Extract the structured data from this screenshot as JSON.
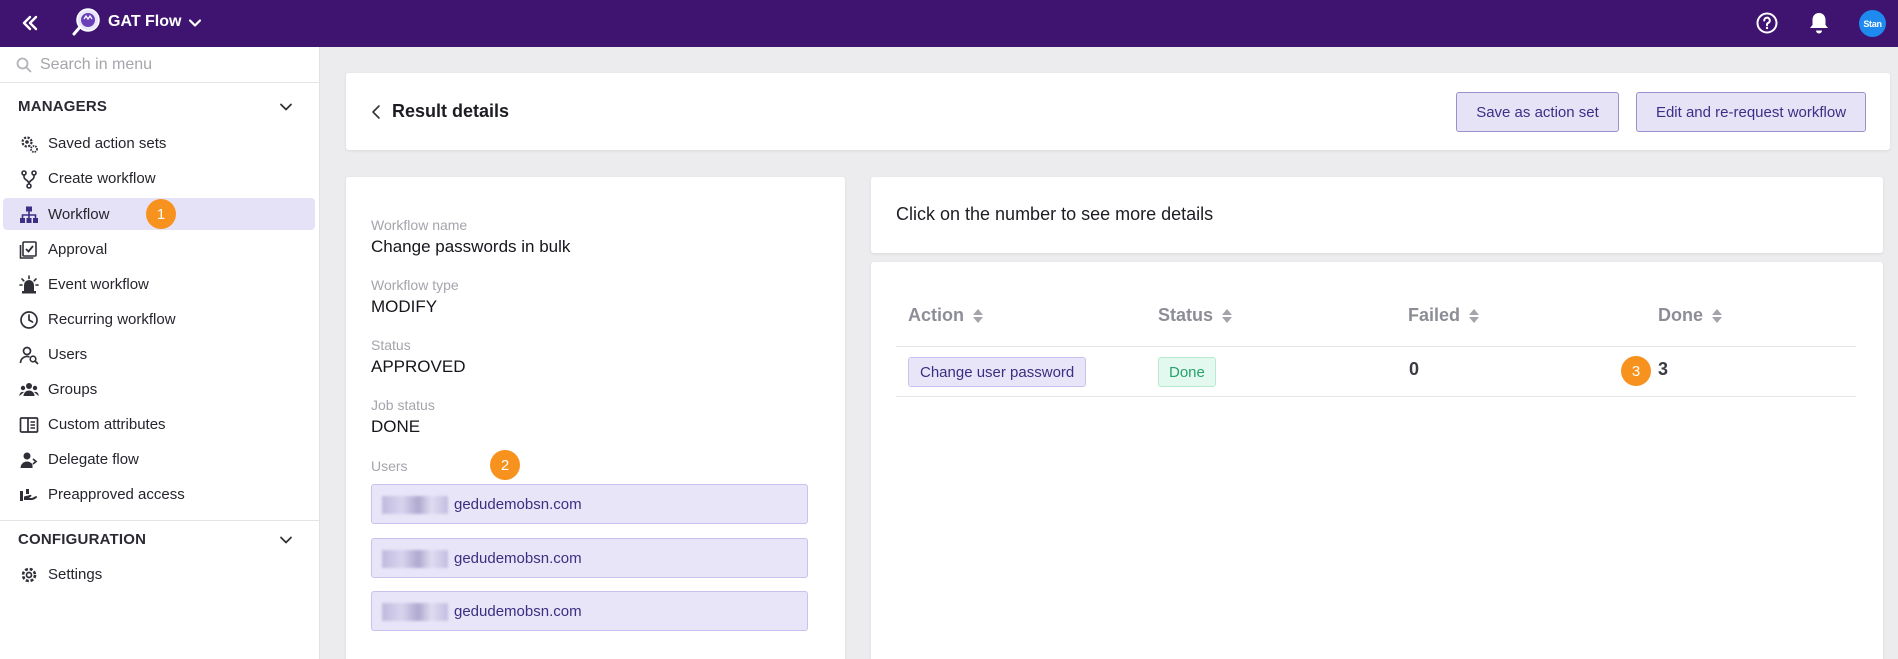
{
  "app": {
    "title": "GAT Flow",
    "brand_color": "#3e1470",
    "avatar_text": "Stan"
  },
  "sidebar": {
    "search_placeholder": "Search in menu",
    "sections": [
      {
        "label": "MANAGERS",
        "items": [
          {
            "label": "Saved action sets",
            "icon": "gear-cog-icon"
          },
          {
            "label": "Create workflow",
            "icon": "branch-icon"
          },
          {
            "label": "Workflow",
            "icon": "hierarchy-icon",
            "active": true,
            "badge": "1"
          },
          {
            "label": "Approval",
            "icon": "checklist-icon"
          },
          {
            "label": "Event workflow",
            "icon": "siren-icon"
          },
          {
            "label": "Recurring workflow",
            "icon": "clock-icon"
          },
          {
            "label": "Users",
            "icon": "user-search-icon"
          },
          {
            "label": "Groups",
            "icon": "group-icon"
          },
          {
            "label": "Custom attributes",
            "icon": "book-icon"
          },
          {
            "label": "Delegate flow",
            "icon": "user-arrow-icon"
          },
          {
            "label": "Preapproved access",
            "icon": "hand-icon"
          }
        ]
      },
      {
        "label": "CONFIGURATION",
        "items": [
          {
            "label": "Settings",
            "icon": "settings-icon"
          }
        ]
      }
    ]
  },
  "header": {
    "title": "Result details",
    "save_label": "Save as action set",
    "edit_label": "Edit and re-request workflow"
  },
  "details": {
    "workflow_name_label": "Workflow name",
    "workflow_name": "Change passwords in bulk",
    "workflow_type_label": "Workflow type",
    "workflow_type": "MODIFY",
    "status_label": "Status",
    "status": "APPROVED",
    "job_status_label": "Job status",
    "job_status": "DONE",
    "users_label": "Users",
    "users_badge": "2",
    "users": [
      "gedudemobsn.com",
      "gedudemobsn.com",
      "gedudemobsn.com"
    ]
  },
  "info": {
    "text": "Click on the number to see more details"
  },
  "table": {
    "columns": [
      "Action",
      "Status",
      "Failed",
      "Done"
    ],
    "rows": [
      {
        "action": "Change user password",
        "status": "Done",
        "failed": "0",
        "done": "3",
        "badge": "3"
      }
    ]
  },
  "colors": {
    "accent": "#3c2f86",
    "badge": "#f7921e",
    "success": "#27a36b"
  }
}
